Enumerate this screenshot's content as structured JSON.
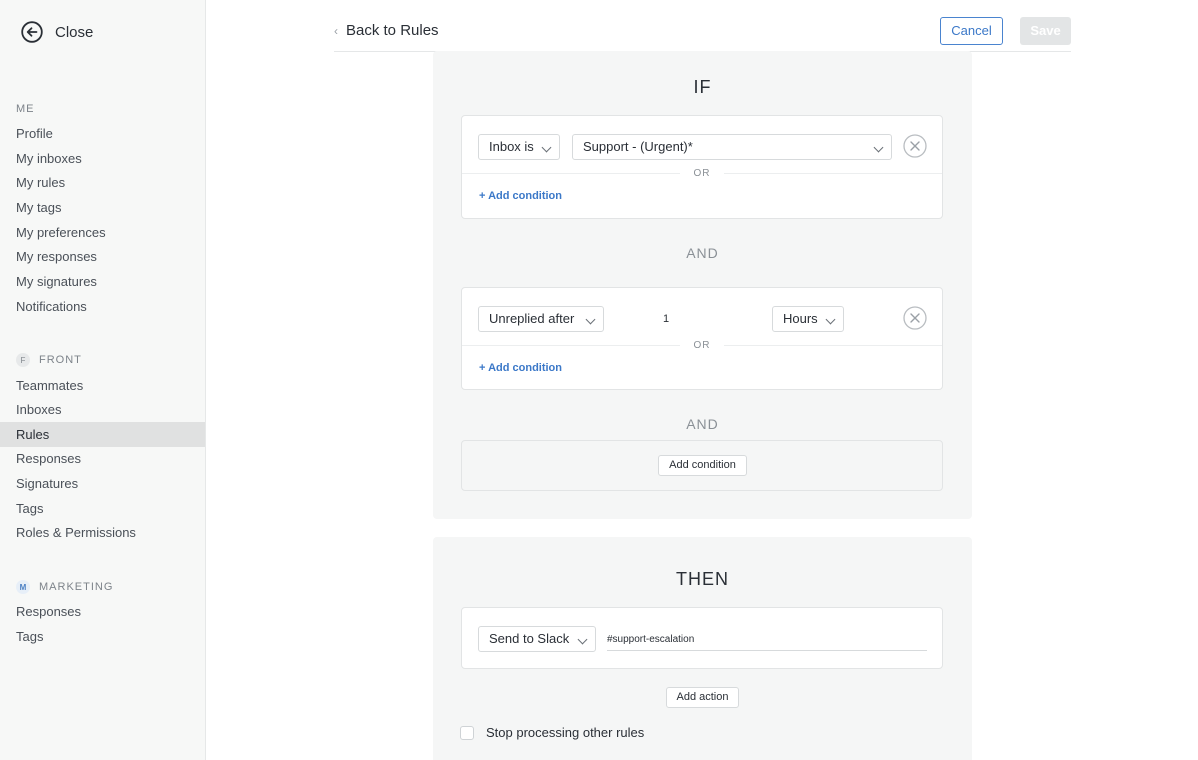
{
  "sidebar": {
    "close_label": "Close",
    "sections": [
      {
        "title": "ME",
        "badge": "",
        "items": [
          "Profile",
          "My inboxes",
          "My rules",
          "My tags",
          "My preferences",
          "My responses",
          "My signatures",
          "Notifications"
        ]
      },
      {
        "title": "FRONT",
        "badge": "F",
        "items": [
          "Teammates",
          "Inboxes",
          "Rules",
          "Responses",
          "Signatures",
          "Tags",
          "Roles & Permissions"
        ]
      },
      {
        "title": "MARKETING",
        "badge": "M",
        "items": [
          "Responses",
          "Tags"
        ]
      }
    ],
    "active_item": "Rules"
  },
  "header": {
    "back_label": "Back to Rules",
    "cancel_label": "Cancel",
    "save_label": "Save"
  },
  "if_panel": {
    "title": "IF",
    "condition1": {
      "type_label": "Inbox is",
      "value_label": "Support - (Urgent)*",
      "or_label": "OR",
      "add_condition": "+ Add condition"
    },
    "and1": "AND",
    "condition2": {
      "type_label": "Unreplied after",
      "amount": "1",
      "unit_label": "Hours",
      "or_label": "OR",
      "add_condition": "+ Add condition"
    },
    "and2": "AND",
    "add_condition_button": "Add condition"
  },
  "then_panel": {
    "title": "THEN",
    "action": {
      "type_label": "Send to Slack",
      "channel_value": "#support-escalation"
    },
    "add_action_button": "Add action",
    "stop_processing_label": "Stop processing other rules"
  },
  "colors": {
    "accent": "#3b78c8",
    "sidebar_bg": "#f7f8f7",
    "panel_bg": "#f5f6f6",
    "active_bg": "#e0e1e1"
  }
}
